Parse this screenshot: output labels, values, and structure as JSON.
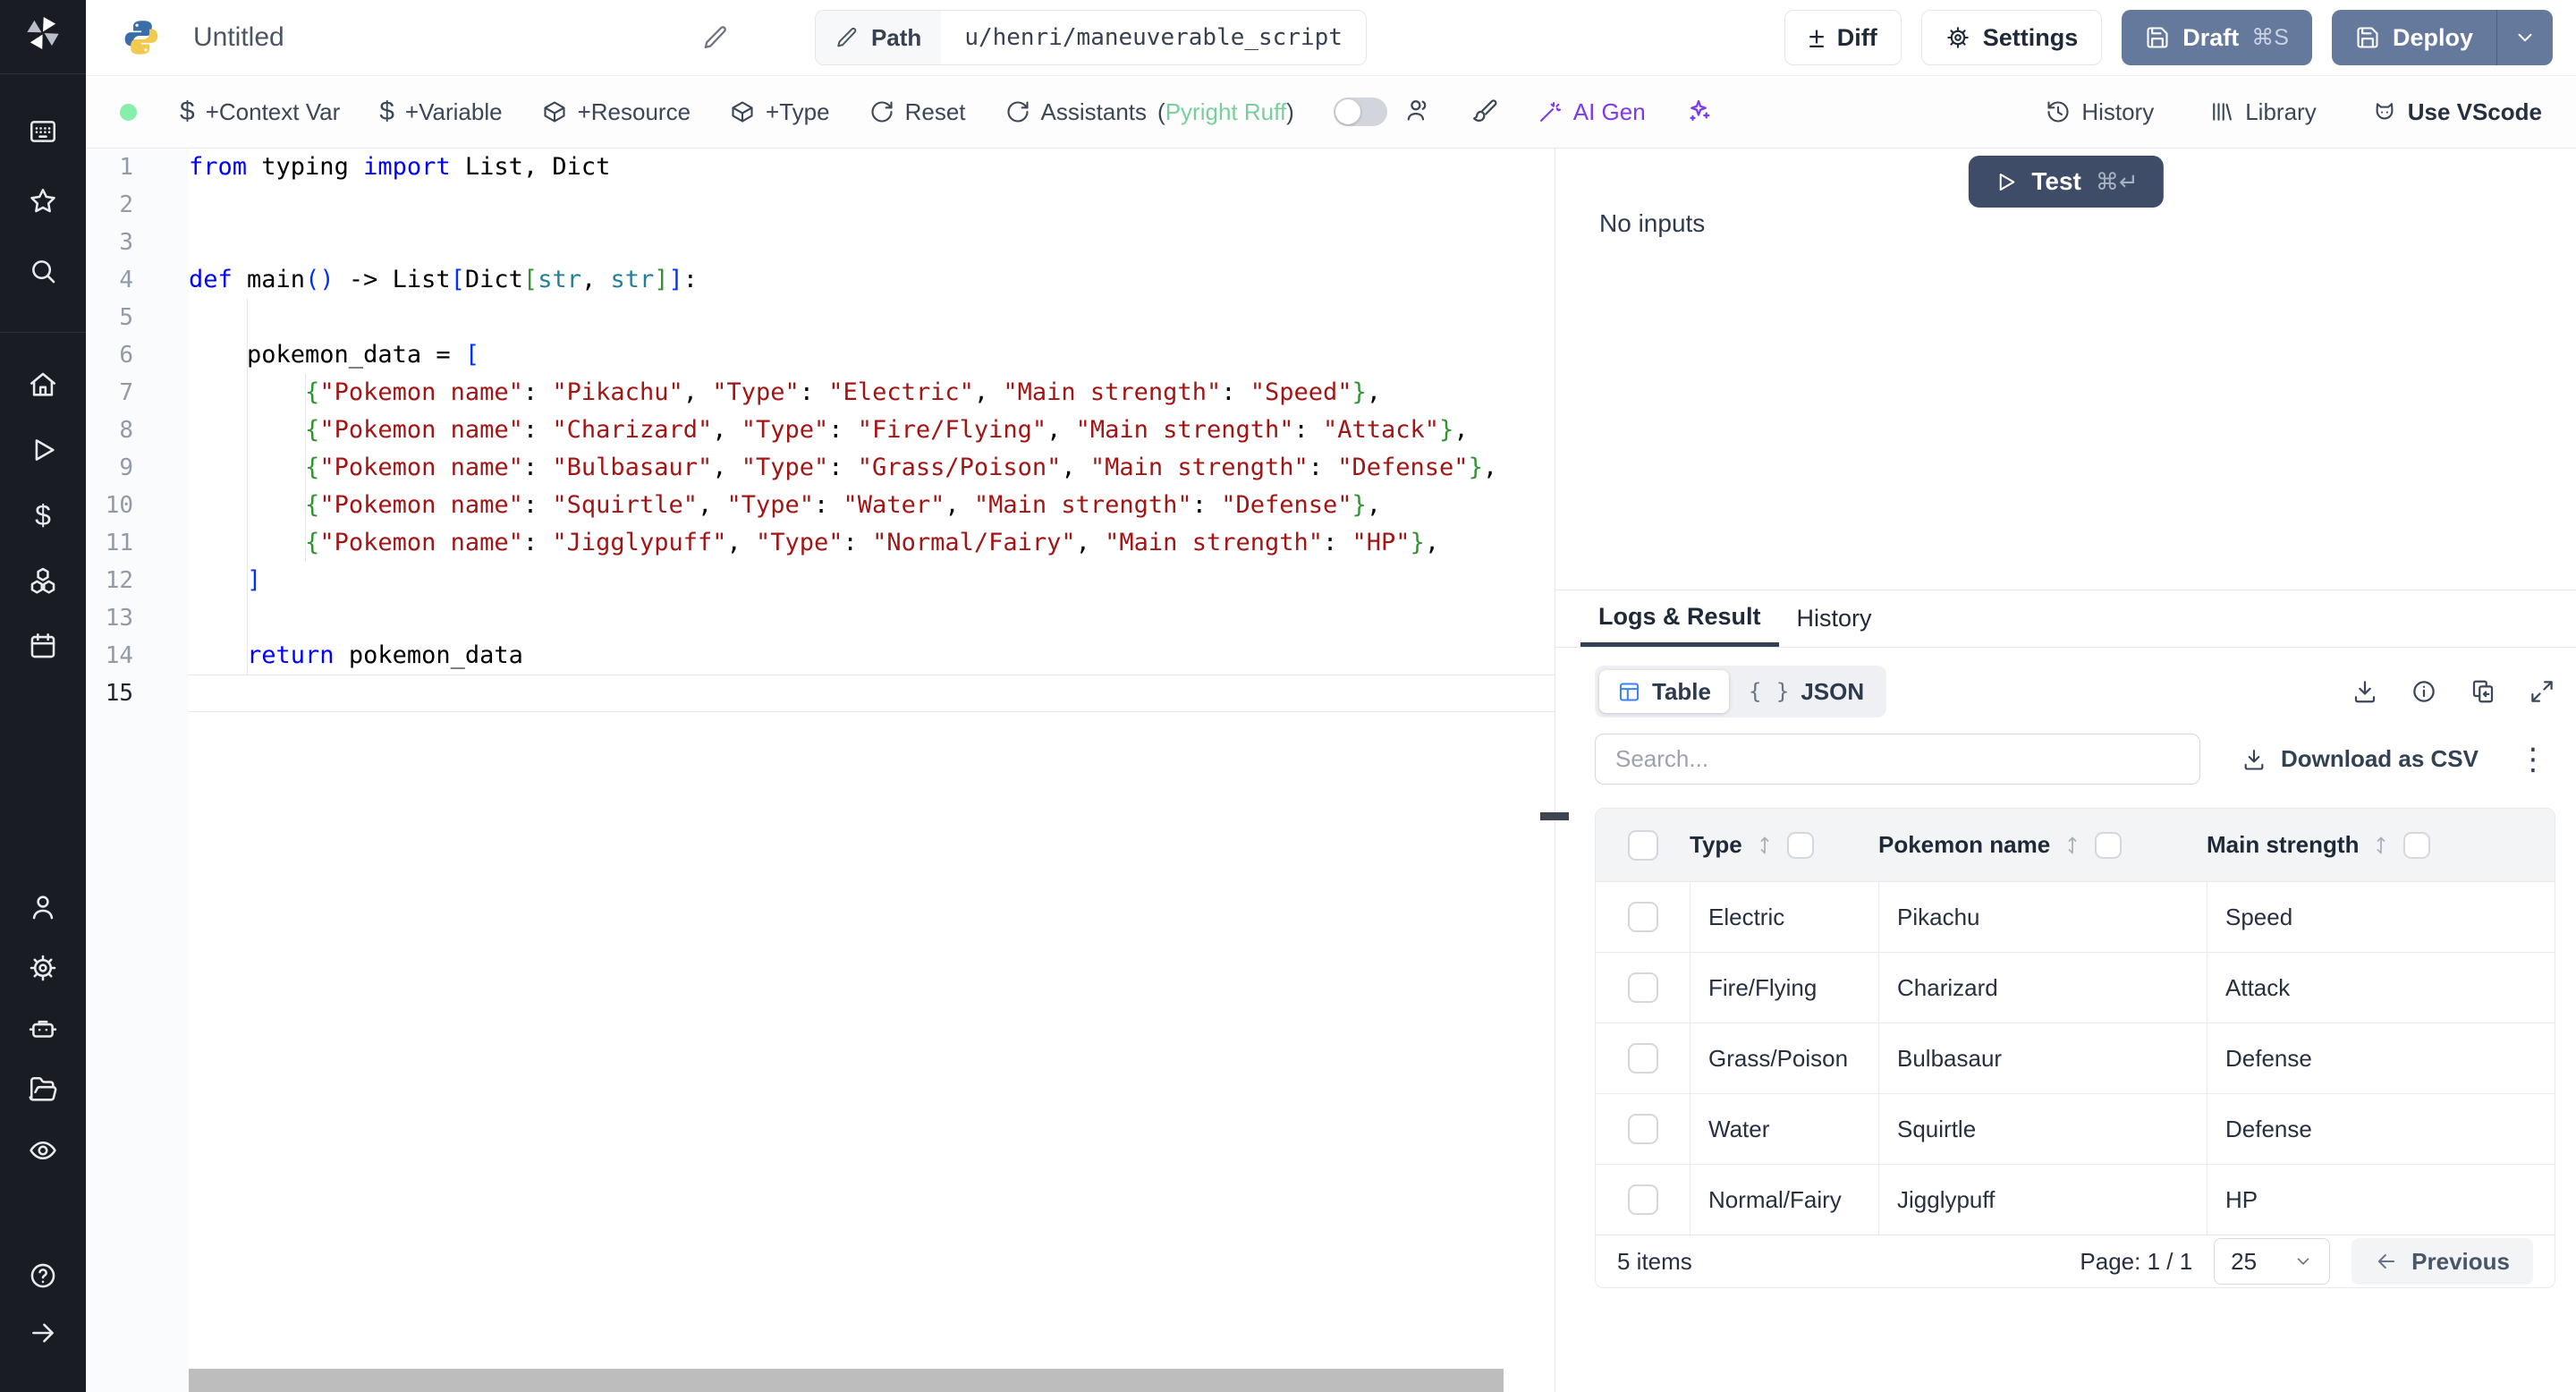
{
  "app": {
    "title": "Untitled"
  },
  "header": {
    "path_label": "Path",
    "path_value": "u/henri/maneuverable_script",
    "diff_label": "Diff",
    "settings_label": "Settings",
    "draft_label": "Draft",
    "draft_shortcut": "⌘S",
    "deploy_label": "Deploy"
  },
  "toolbar": {
    "context_var": "+Context Var",
    "variable": "+Variable",
    "resource": "+Resource",
    "type": "+Type",
    "reset": "Reset",
    "assistants": "Assistants",
    "paren_open": "(",
    "assistants_lang": "Pyright Ruff",
    "paren_close": ")",
    "ai_gen": "AI Gen",
    "history": "History",
    "library": "Library",
    "use_vscode": "Use VScode"
  },
  "icons": {
    "dollar": "$",
    "diff": "±",
    "json_braces": "{ }",
    "kebab": "⋮"
  },
  "editor": {
    "lines": [
      [
        {
          "t": "from",
          "c": "k"
        },
        {
          "t": " typing ",
          "c": "p"
        },
        {
          "t": "import",
          "c": "k"
        },
        {
          "t": " List, Dict",
          "c": "p"
        }
      ],
      [],
      [],
      [
        {
          "t": "def",
          "c": "k"
        },
        {
          "t": " main",
          "c": "p"
        },
        {
          "t": "()",
          "c": "b1"
        },
        {
          "t": " -> List",
          "c": "p"
        },
        {
          "t": "[",
          "c": "b1"
        },
        {
          "t": "Dict",
          "c": "p"
        },
        {
          "t": "[",
          "c": "b2"
        },
        {
          "t": "str",
          "c": "t"
        },
        {
          "t": ", ",
          "c": "p"
        },
        {
          "t": "str",
          "c": "t"
        },
        {
          "t": "]",
          "c": "b2"
        },
        {
          "t": "]",
          "c": "b1"
        },
        {
          "t": ":",
          "c": "p"
        }
      ],
      [],
      [
        {
          "t": "    pokemon_data = ",
          "c": "p"
        },
        {
          "t": "[",
          "c": "b1"
        }
      ],
      [
        {
          "t": "        ",
          "c": "p"
        },
        {
          "t": "{",
          "c": "b2"
        },
        {
          "t": "\"Pokemon name\"",
          "c": "s"
        },
        {
          "t": ": ",
          "c": "p"
        },
        {
          "t": "\"Pikachu\"",
          "c": "s"
        },
        {
          "t": ", ",
          "c": "p"
        },
        {
          "t": "\"Type\"",
          "c": "s"
        },
        {
          "t": ": ",
          "c": "p"
        },
        {
          "t": "\"Electric\"",
          "c": "s"
        },
        {
          "t": ", ",
          "c": "p"
        },
        {
          "t": "\"Main strength\"",
          "c": "s"
        },
        {
          "t": ": ",
          "c": "p"
        },
        {
          "t": "\"Speed\"",
          "c": "s"
        },
        {
          "t": "}",
          "c": "b2"
        },
        {
          "t": ",",
          "c": "p"
        }
      ],
      [
        {
          "t": "        ",
          "c": "p"
        },
        {
          "t": "{",
          "c": "b2"
        },
        {
          "t": "\"Pokemon name\"",
          "c": "s"
        },
        {
          "t": ": ",
          "c": "p"
        },
        {
          "t": "\"Charizard\"",
          "c": "s"
        },
        {
          "t": ", ",
          "c": "p"
        },
        {
          "t": "\"Type\"",
          "c": "s"
        },
        {
          "t": ": ",
          "c": "p"
        },
        {
          "t": "\"Fire/Flying\"",
          "c": "s"
        },
        {
          "t": ", ",
          "c": "p"
        },
        {
          "t": "\"Main strength\"",
          "c": "s"
        },
        {
          "t": ": ",
          "c": "p"
        },
        {
          "t": "\"Attack\"",
          "c": "s"
        },
        {
          "t": "}",
          "c": "b2"
        },
        {
          "t": ",",
          "c": "p"
        }
      ],
      [
        {
          "t": "        ",
          "c": "p"
        },
        {
          "t": "{",
          "c": "b2"
        },
        {
          "t": "\"Pokemon name\"",
          "c": "s"
        },
        {
          "t": ": ",
          "c": "p"
        },
        {
          "t": "\"Bulbasaur\"",
          "c": "s"
        },
        {
          "t": ", ",
          "c": "p"
        },
        {
          "t": "\"Type\"",
          "c": "s"
        },
        {
          "t": ": ",
          "c": "p"
        },
        {
          "t": "\"Grass/Poison\"",
          "c": "s"
        },
        {
          "t": ", ",
          "c": "p"
        },
        {
          "t": "\"Main strength\"",
          "c": "s"
        },
        {
          "t": ": ",
          "c": "p"
        },
        {
          "t": "\"Defense\"",
          "c": "s"
        },
        {
          "t": "}",
          "c": "b2"
        },
        {
          "t": ",",
          "c": "p"
        }
      ],
      [
        {
          "t": "        ",
          "c": "p"
        },
        {
          "t": "{",
          "c": "b2"
        },
        {
          "t": "\"Pokemon name\"",
          "c": "s"
        },
        {
          "t": ": ",
          "c": "p"
        },
        {
          "t": "\"Squirtle\"",
          "c": "s"
        },
        {
          "t": ", ",
          "c": "p"
        },
        {
          "t": "\"Type\"",
          "c": "s"
        },
        {
          "t": ": ",
          "c": "p"
        },
        {
          "t": "\"Water\"",
          "c": "s"
        },
        {
          "t": ", ",
          "c": "p"
        },
        {
          "t": "\"Main strength\"",
          "c": "s"
        },
        {
          "t": ": ",
          "c": "p"
        },
        {
          "t": "\"Defense\"",
          "c": "s"
        },
        {
          "t": "}",
          "c": "b2"
        },
        {
          "t": ",",
          "c": "p"
        }
      ],
      [
        {
          "t": "        ",
          "c": "p"
        },
        {
          "t": "{",
          "c": "b2"
        },
        {
          "t": "\"Pokemon name\"",
          "c": "s"
        },
        {
          "t": ": ",
          "c": "p"
        },
        {
          "t": "\"Jigglypuff\"",
          "c": "s"
        },
        {
          "t": ", ",
          "c": "p"
        },
        {
          "t": "\"Type\"",
          "c": "s"
        },
        {
          "t": ": ",
          "c": "p"
        },
        {
          "t": "\"Normal/Fairy\"",
          "c": "s"
        },
        {
          "t": ", ",
          "c": "p"
        },
        {
          "t": "\"Main strength\"",
          "c": "s"
        },
        {
          "t": ": ",
          "c": "p"
        },
        {
          "t": "\"HP\"",
          "c": "s"
        },
        {
          "t": "}",
          "c": "b2"
        },
        {
          "t": ",",
          "c": "p"
        }
      ],
      [
        {
          "t": "    ",
          "c": "p"
        },
        {
          "t": "]",
          "c": "b1"
        }
      ],
      [],
      [
        {
          "t": "    ",
          "c": "p"
        },
        {
          "t": "return",
          "c": "k"
        },
        {
          "t": " pokemon_data",
          "c": "p"
        }
      ],
      []
    ],
    "active_line": 15
  },
  "run": {
    "test_label": "Test",
    "test_shortcut": "⌘↵",
    "no_inputs": "No inputs"
  },
  "tabs": {
    "logs_result": "Logs & Result",
    "history": "History"
  },
  "result": {
    "view_table": "Table",
    "view_json": "JSON",
    "search_placeholder": "Search...",
    "download_csv": "Download as CSV",
    "table": {
      "columns": [
        "Type",
        "Pokemon name",
        "Main strength"
      ],
      "rows": [
        [
          "Electric",
          "Pikachu",
          "Speed"
        ],
        [
          "Fire/Flying",
          "Charizard",
          "Attack"
        ],
        [
          "Grass/Poison",
          "Bulbasaur",
          "Defense"
        ],
        [
          "Water",
          "Squirtle",
          "Defense"
        ],
        [
          "Normal/Fairy",
          "Jigglypuff",
          "HP"
        ]
      ]
    },
    "footer": {
      "count": "5 items",
      "page": "Page: 1 / 1",
      "page_size": "25",
      "previous": "Previous"
    }
  },
  "colors": {
    "steel_button": "#64799c",
    "test_button": "#3e4c67",
    "accent_blue": "#3b82f6",
    "ai_purple": "#7c3aed",
    "status_green": "#86efac",
    "ruff_green": "#79cf9b",
    "sidebar_bg": "#191c23"
  }
}
